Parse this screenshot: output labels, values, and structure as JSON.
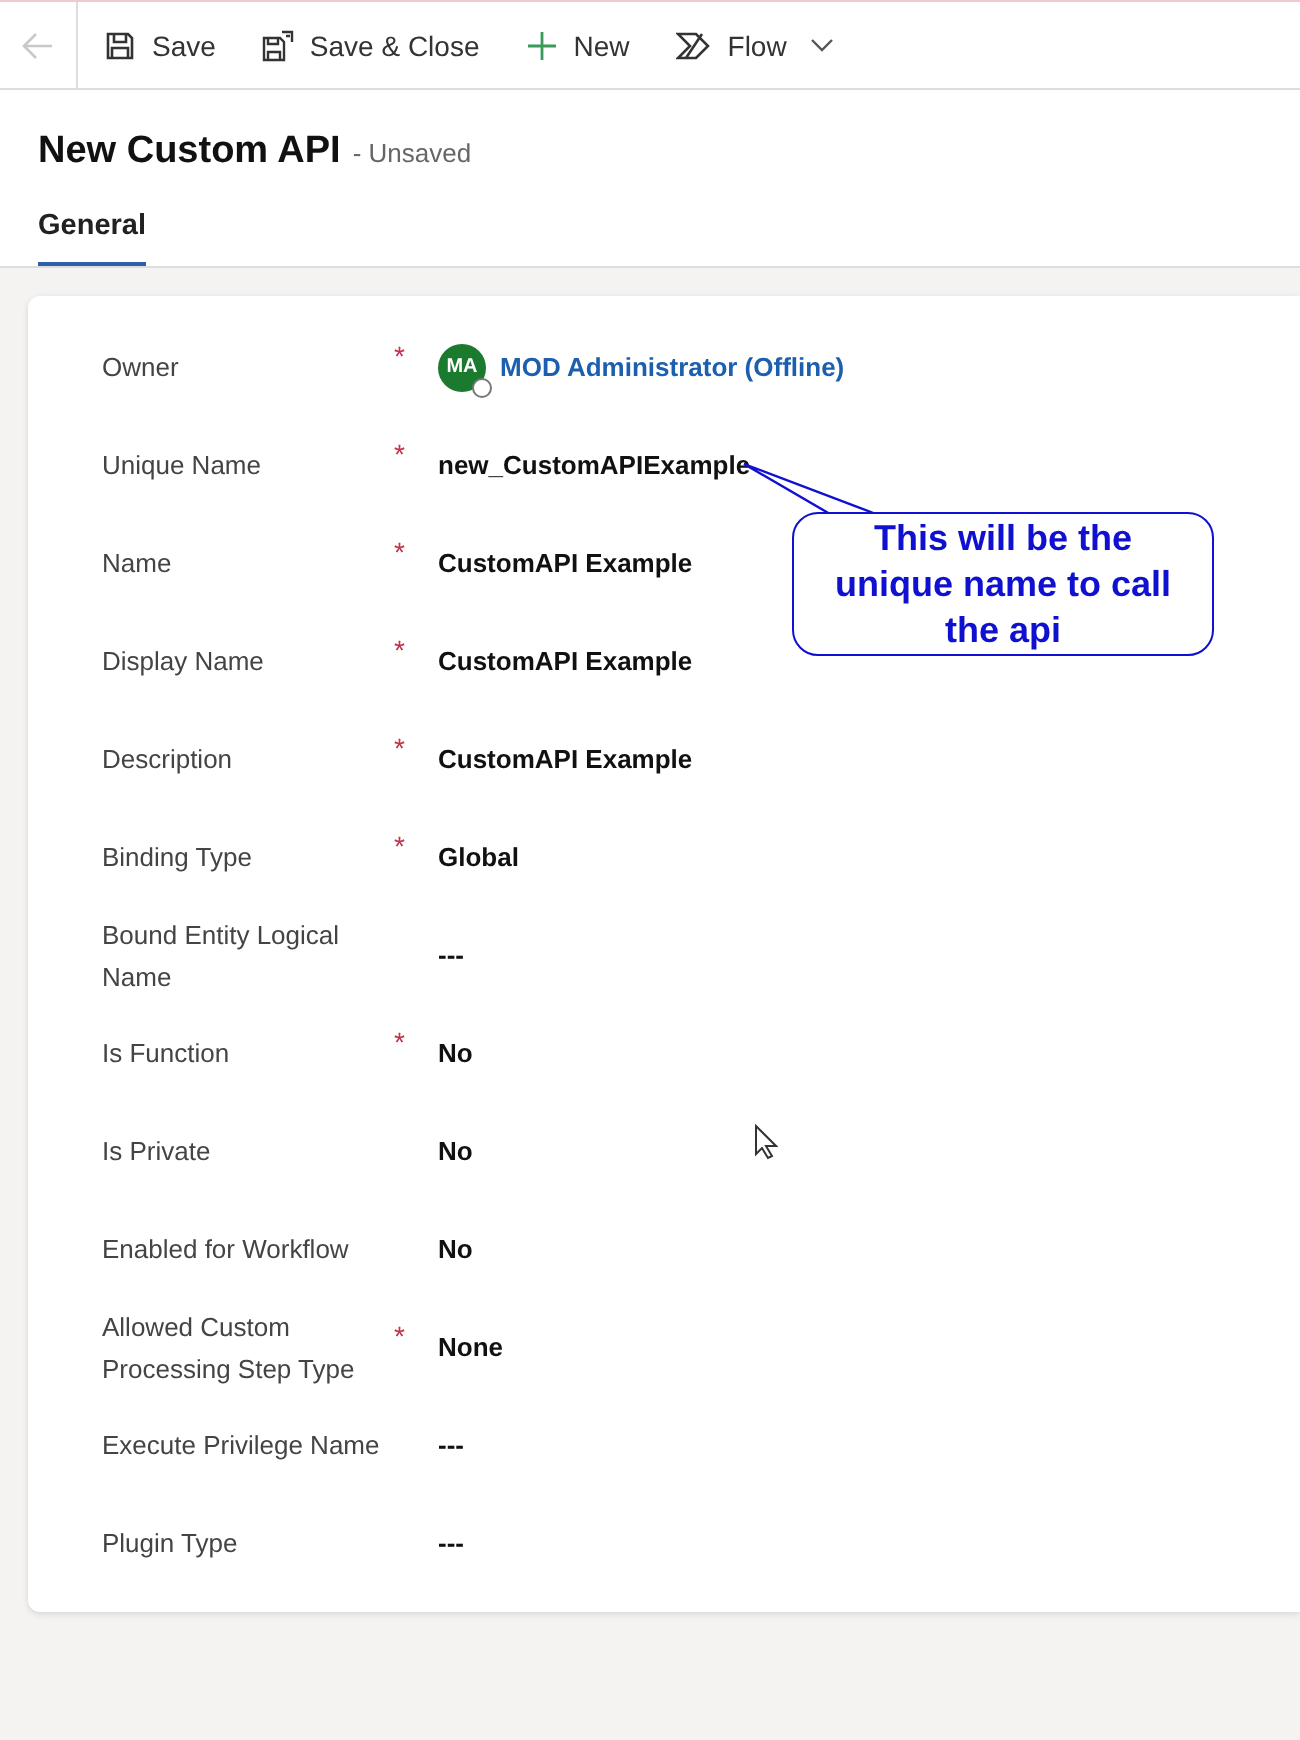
{
  "toolbar": {
    "back": {
      "disabled": true
    },
    "commands": [
      {
        "kind": "save",
        "label": "Save"
      },
      {
        "kind": "save-close",
        "label": "Save & Close"
      },
      {
        "kind": "new",
        "label": "New"
      },
      {
        "kind": "flow",
        "label": "Flow"
      }
    ]
  },
  "header": {
    "title": "New Custom API",
    "status": "- Unsaved"
  },
  "tabs": [
    {
      "label": "General",
      "selected": true
    }
  ],
  "fields": [
    {
      "label": "Owner",
      "required_mark": "*",
      "kind": "lookup",
      "initials": "MA",
      "value": "MOD Administrator (Offline)"
    },
    {
      "label": "Unique Name",
      "required_mark": "*",
      "kind": "text",
      "value": "new_CustomAPIExample"
    },
    {
      "label": "Name",
      "required_mark": "*",
      "kind": "text",
      "value": "CustomAPI Example"
    },
    {
      "label": "Display Name",
      "required_mark": "*",
      "kind": "text",
      "value": "CustomAPI Example"
    },
    {
      "label": "Description",
      "required_mark": "*",
      "kind": "text",
      "value": "CustomAPI Example"
    },
    {
      "label": "Binding Type",
      "required_mark": "*",
      "kind": "text",
      "value": "Global"
    },
    {
      "label": "Bound Entity Logical Name",
      "kind": "text",
      "value": "---"
    },
    {
      "label": "Is Function",
      "required_mark": "*",
      "kind": "text",
      "value": "No"
    },
    {
      "label": "Is Private",
      "kind": "text",
      "value": "No"
    },
    {
      "label": "Enabled for Workflow",
      "kind": "text",
      "value": "No"
    },
    {
      "label": "Allowed Custom Processing Step Type",
      "required_mark": "*",
      "kind": "text",
      "value": "None"
    },
    {
      "label": "Execute Privilege Name",
      "kind": "text",
      "value": "---"
    },
    {
      "label": "Plugin Type",
      "kind": "text",
      "value": "---"
    }
  ],
  "callout": {
    "text": "This will be the unique name to call the api"
  }
}
